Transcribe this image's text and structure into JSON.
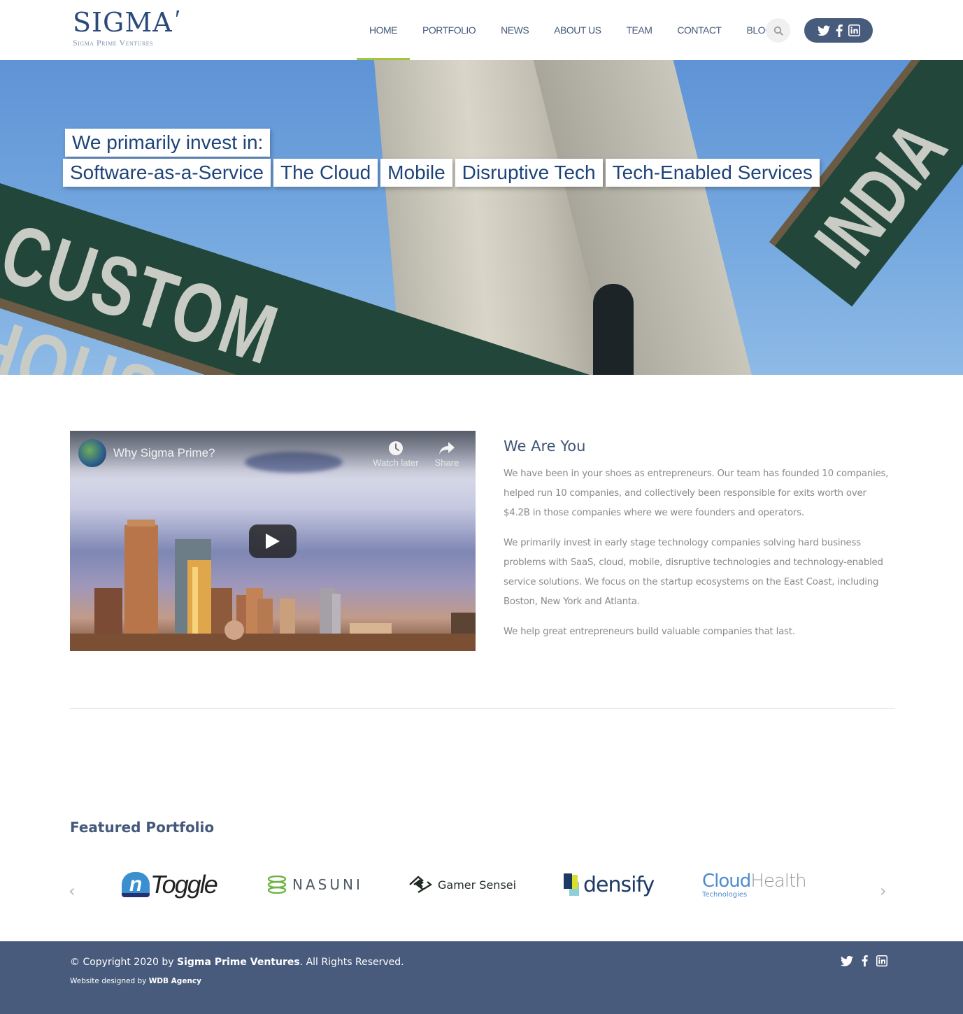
{
  "header": {
    "logo": {
      "main": "SIGMA",
      "mark": "′",
      "sub": "Sigma Prime Ventures"
    },
    "nav": [
      {
        "label": "HOME",
        "active": true
      },
      {
        "label": "PORTFOLIO",
        "active": false
      },
      {
        "label": "NEWS",
        "active": false
      },
      {
        "label": "ABOUT US",
        "active": false
      },
      {
        "label": "TEAM",
        "active": false
      },
      {
        "label": "CONTACT",
        "active": false
      },
      {
        "label": "BLOG",
        "active": false
      }
    ],
    "search_icon": "search-icon",
    "social": [
      "twitter-icon",
      "facebook-icon",
      "linkedin-icon"
    ],
    "accent_color": "#a6c43c"
  },
  "hero": {
    "background_text": {
      "sign_left": "CUSTOM HOUSE ST",
      "sign_right": "INDIA"
    },
    "intro": "We primarily invest in:",
    "tags": [
      "Software-as-a-Service",
      "The Cloud",
      "Mobile",
      "Disruptive Tech",
      "Tech-Enabled Services"
    ],
    "tag_color": "#1d4378"
  },
  "video": {
    "title": "Why Sigma Prime?",
    "watch_later": "Watch later",
    "share": "Share"
  },
  "about": {
    "heading": "We Are You",
    "paragraphs": [
      "We have been in your shoes as entrepreneurs. Our team has founded 10 companies, helped run 10 companies, and collectively been responsible for exits worth over $4.2B in those companies where we were founders and operators.",
      "We primarily invest in early stage technology companies solving hard business problems with SaaS, cloud, mobile, disruptive technologies and technology-enabled service solutions. We focus on the startup ecosystems on the East Coast, including Boston, New York and Atlanta.",
      "We help great entrepreneurs build valuable companies that last."
    ]
  },
  "portfolio": {
    "title": "Featured Portfolio",
    "prev": "‹",
    "next": "›",
    "logos": [
      {
        "name": "nToggle",
        "n": "n",
        "text": "Toggle"
      },
      {
        "name": "Nasuni",
        "text": "NASUNI",
        "reg": "."
      },
      {
        "name": "Gamer Sensei",
        "text": "Gamer Sensei"
      },
      {
        "name": "densify",
        "text": "densify"
      },
      {
        "name": "CloudHealth Technologies",
        "a": "Cloud",
        "b": "Health",
        "c": "Technologies"
      }
    ]
  },
  "footer": {
    "copy_prefix": "© Copyright 2020 by ",
    "company": "Sigma Prime Ventures",
    "copy_suffix": ". All Rights Reserved.",
    "credit_prefix": "Website designed by ",
    "credit_agency": "WDB Agency",
    "social": [
      "twitter-icon",
      "facebook-icon",
      "linkedin-icon"
    ],
    "bg_color": "#485b7c"
  }
}
